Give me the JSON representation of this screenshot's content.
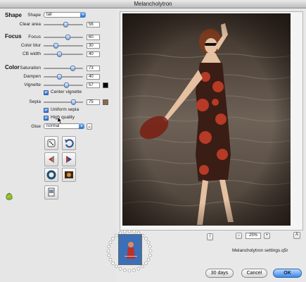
{
  "window": {
    "title": "Melancholytron"
  },
  "shape": {
    "section": "Shape",
    "shape_label": "Shape",
    "shape_value": "tall",
    "clear_area_label": "Clear area",
    "clear_area_value": "56",
    "clear_area_fraction": 0.56
  },
  "focus": {
    "section": "Focus",
    "focus_label": "Focus",
    "focus_value": "60",
    "focus_fraction": 0.6,
    "color_blur_label": "Color blur",
    "color_blur_value": "30",
    "color_blur_fraction": 0.3,
    "cb_width_label": "CB width",
    "cb_width_value": "40",
    "cb_width_fraction": 0.4
  },
  "color": {
    "section": "Color",
    "saturation_label": "Saturation",
    "saturation_value": "73",
    "saturation_fraction": 0.73,
    "dampen_label": "Dampen",
    "dampen_value": "40",
    "dampen_fraction": 0.4,
    "vignette_label": "Vignette",
    "vignette_value": "57",
    "vignette_fraction": 0.57,
    "vignette_color": "#000000",
    "center_vignette_label": "Center vignette",
    "sepia_label": "Sepia",
    "sepia_value": "75",
    "sepia_fraction": 0.75,
    "sepia_color": "#8a6a47",
    "uniform_sepia_label": "Uniform sepia",
    "high_quality_label": "High quality",
    "glue_label": "Glue",
    "glue_value": "normal",
    "glue_extra": "••"
  },
  "tools": [
    {
      "name": "random-dice-icon"
    },
    {
      "name": "undo-arrow-icon"
    },
    {
      "name": "preview-left-icon"
    },
    {
      "name": "preview-right-icon"
    },
    {
      "name": "vignette-ring-icon"
    },
    {
      "name": "film-image-icon"
    },
    {
      "name": "save-image-icon"
    }
  ],
  "preview": {
    "zoom_minus": "–",
    "zoom_value": "25%",
    "zoom_plus": "+",
    "corner_a": "A",
    "settings_file": "Melancholytron settings.q5r"
  },
  "buttons": {
    "trial": "30 days",
    "cancel": "Cancel",
    "ok": "OK"
  }
}
